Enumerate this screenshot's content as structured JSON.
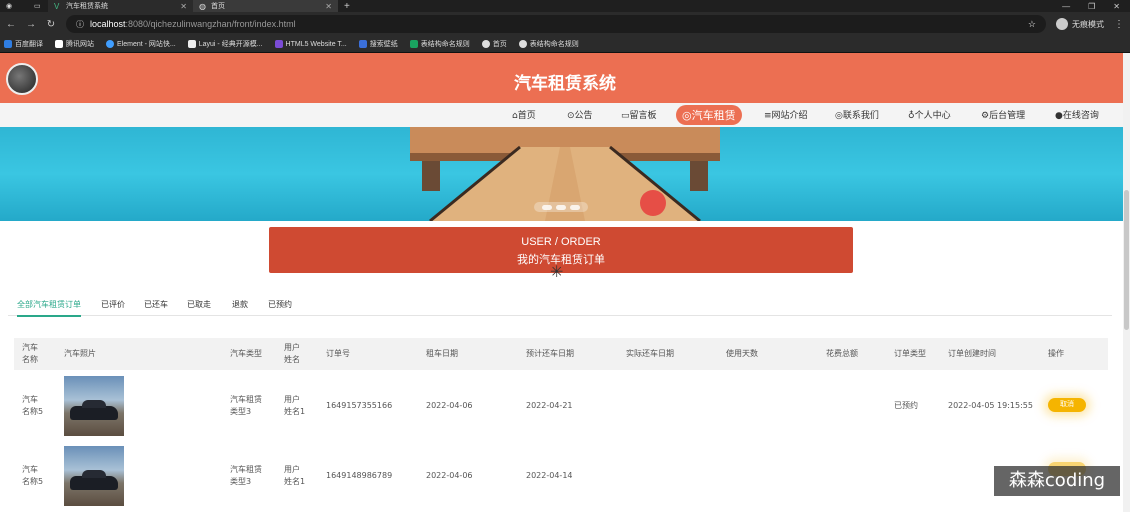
{
  "browser": {
    "tabs": [
      {
        "label": "汽车租赁系统",
        "active": false
      },
      {
        "label": "首页",
        "active": true
      }
    ],
    "url_host": "localhost",
    "url_rest": ":8080/qichezulinwangzhan/front/index.html",
    "profile_label": "无痕模式",
    "bookmarks": [
      "百度翻译",
      "腾讯网站",
      "Element - 网站快...",
      "Layui - 经典开源模...",
      "HTML5 Website T...",
      "搜索壁纸",
      "表结构命名规则",
      "首页",
      "表结构命名规则"
    ]
  },
  "site": {
    "title": "汽车租赁系统",
    "nav": [
      {
        "label": "⌂首页",
        "active": false
      },
      {
        "label": "⊙公告",
        "active": false
      },
      {
        "label": "▭留言板",
        "active": false
      },
      {
        "label": "◎汽车租赁",
        "active": true
      },
      {
        "label": "≡网站介绍",
        "active": false
      },
      {
        "label": "◎联系我们",
        "active": false
      },
      {
        "label": "♁个人中心",
        "active": false
      },
      {
        "label": "⚙后台管理",
        "active": false
      },
      {
        "label": "●在线咨询",
        "active": false
      }
    ]
  },
  "order_section": {
    "title_en": "USER / ORDER",
    "title_zh": "我的汽车租赁订单"
  },
  "filter_tabs": [
    "全部汽车租赁订单",
    "已评价",
    "已还车",
    "已取走",
    "退款",
    "已预约"
  ],
  "table": {
    "headers": [
      "汽车\n名称",
      "汽车照片",
      "汽车类型",
      "用户\n姓名",
      "订单号",
      "租车日期",
      "预计还车日期",
      "实际还车日期",
      "使用天数",
      "花费总额",
      "订单类型",
      "订单创建时间",
      "操作"
    ],
    "rows": [
      {
        "car_name": "汽车\n名称5",
        "car_type": "汽车租赁\n类型3",
        "user_name": "用户\n姓名1",
        "order_no": "1649157355166",
        "rent_date": "2022-04-06",
        "expected_return": "2022-04-21",
        "actual_return": "",
        "days": "",
        "total": "",
        "order_type": "已预约",
        "created": "2022-04-05 19:15:55",
        "action": "取消"
      },
      {
        "car_name": "汽车\n名称5",
        "car_type": "汽车租赁\n类型3",
        "user_name": "用户\n姓名1",
        "order_no": "1649148986789",
        "rent_date": "2022-04-06",
        "expected_return": "2022-04-14",
        "actual_return": "",
        "days": "",
        "total": "",
        "order_type": "",
        "created": "",
        "action": ""
      }
    ]
  },
  "watermark": "森森coding"
}
